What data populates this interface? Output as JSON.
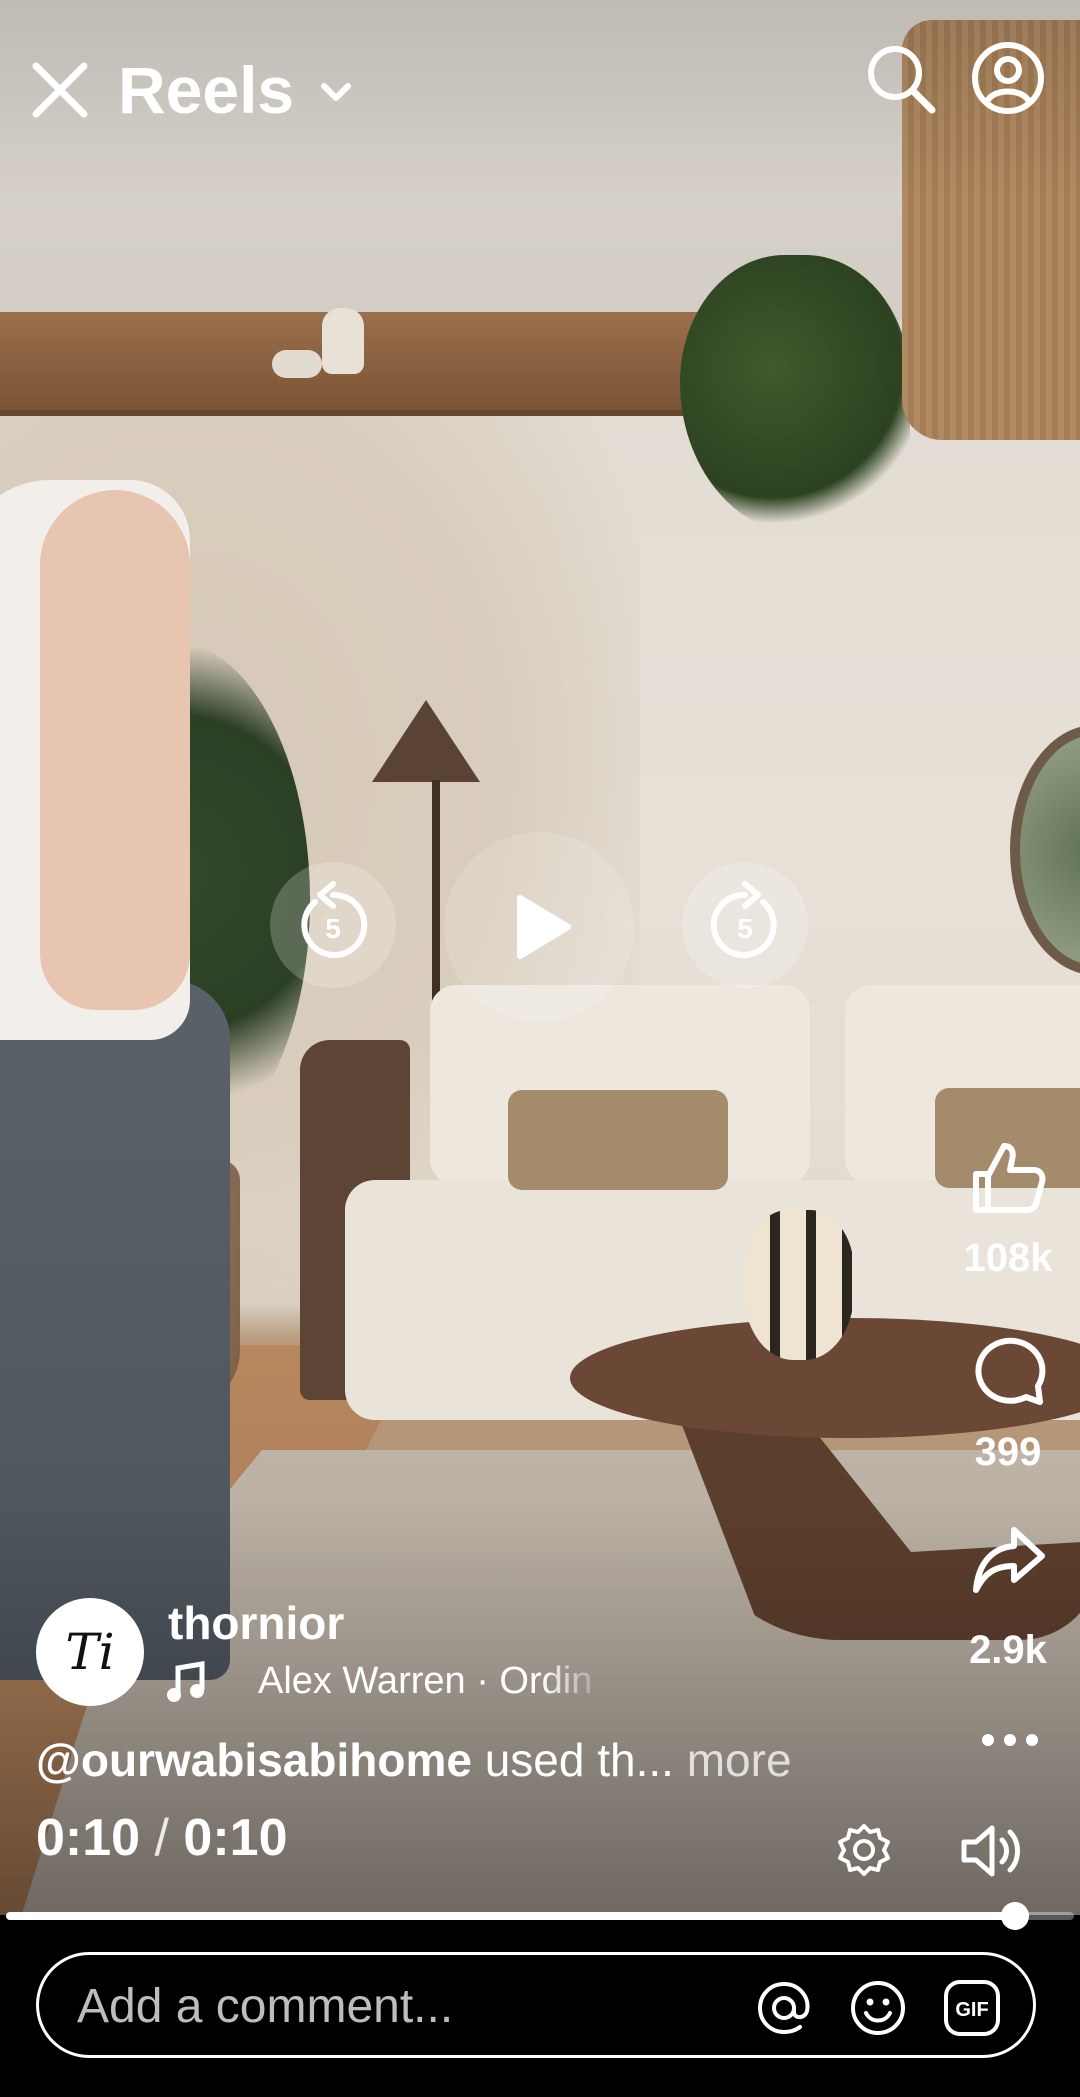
{
  "header": {
    "title": "Reels",
    "icons": {
      "close": "close-icon",
      "dropdown": "chevron-down-icon",
      "search": "search-icon",
      "profile": "profile-icon"
    }
  },
  "playback": {
    "rewind_label": "5",
    "forward_label": "5",
    "icons": {
      "rewind": "rewind-5-icon",
      "play": "play-icon",
      "forward": "forward-5-icon"
    }
  },
  "actions": {
    "likes": "108k",
    "comments": "399",
    "shares": "2.9k",
    "icons": {
      "like": "thumbs-up-icon",
      "comment": "comment-bubble-icon",
      "share": "share-arrow-icon",
      "more": "more-dots-icon"
    }
  },
  "post": {
    "avatar_text": "Ti",
    "username": "thornior",
    "music": "Alex Warren · Ordin",
    "caption_mention": "@ourwabisabihome",
    "caption_text": " used th...",
    "caption_more": " more",
    "time_current": "0:10",
    "time_separator": " / ",
    "time_total": "0:10",
    "progress": 0.945
  },
  "controls": {
    "icons": {
      "settings": "gear-icon",
      "volume": "volume-icon",
      "music": "music-note-icon"
    }
  },
  "comment_bar": {
    "placeholder": "Add a comment...",
    "icons": {
      "mention": "at-sign-icon",
      "emoji": "emoji-icon",
      "gif": "gif-icon"
    },
    "gif_label": "GIF"
  },
  "colors": {
    "accent": "#ffffff",
    "background": "#000000"
  }
}
